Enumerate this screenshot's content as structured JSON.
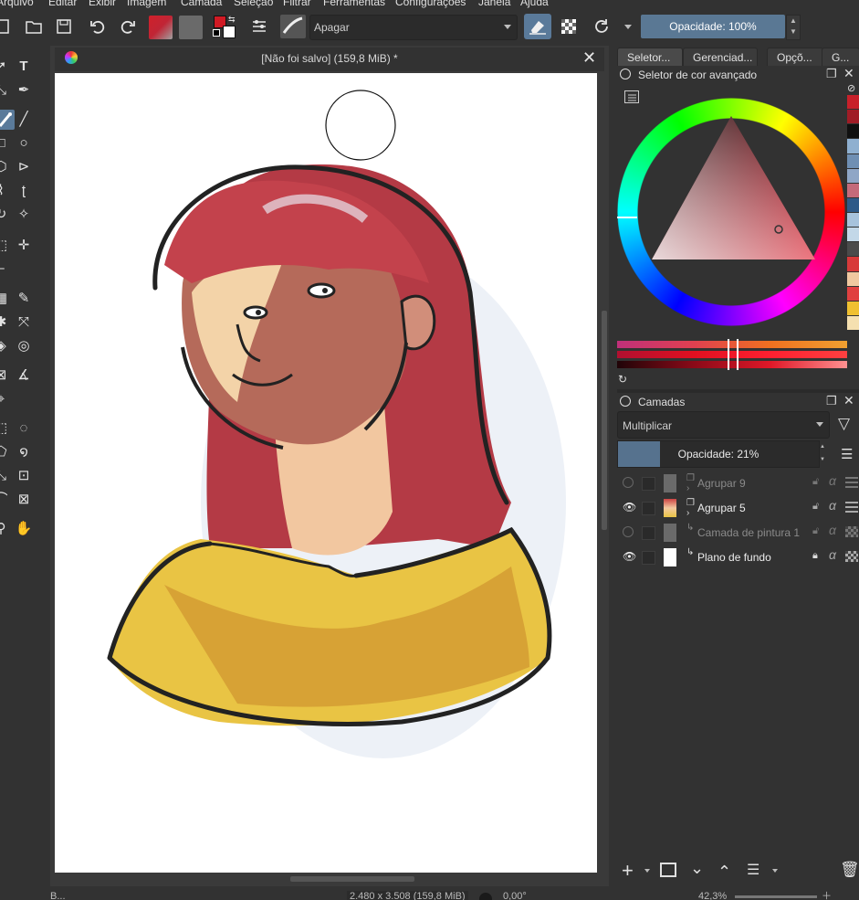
{
  "menu": [
    "Arquivo",
    "Editar",
    "Exibir",
    "Imagem",
    "Camada",
    "Seleção",
    "Filtrar",
    "Ferramentas",
    "Configurações",
    "Janela",
    "Ajuda"
  ],
  "toolbar": {
    "blend_mode": "Apagar",
    "opacity": "Opacidade: 100%"
  },
  "document": {
    "title": "[Não foi salvo]  (159,8 MiB) *"
  },
  "docker_tabs": [
    "Seletor...",
    "Gerenciad...",
    "Opçõ...",
    "G..."
  ],
  "color_selector": {
    "title": "Seletor de cor avançado",
    "palette": [
      "#c8202a",
      "#a01c26",
      "#101010",
      "#8fb0d0",
      "#6f8fb3",
      "#8fa6c6",
      "#c46a7a",
      "#2e5a88",
      "#a7c3dc",
      "#c3d8e8",
      "#4b4b4b",
      "#d83a3a",
      "#f0c8a0",
      "#e04040",
      "#f0c030",
      "#f5e0b0"
    ]
  },
  "layers": {
    "title": "Camadas",
    "blend_mode": "Multiplicar",
    "opacity_label": "Opacidade:  21%",
    "opacity_fraction": 0.21,
    "items": [
      {
        "name": "Agrupar  9",
        "visible": false,
        "dim": true
      },
      {
        "name": "Agrupar  5",
        "visible": true,
        "dim": false
      },
      {
        "name": "Camada de pintura 1",
        "visible": false,
        "dim": true
      },
      {
        "name": "Plano de fundo",
        "visible": true,
        "dim": false
      }
    ]
  },
  "status": {
    "left": "B...",
    "size": "2.480 x 3.508 (159,8 MiB)",
    "rotation": "0,00°",
    "zoom": "42,3%"
  }
}
